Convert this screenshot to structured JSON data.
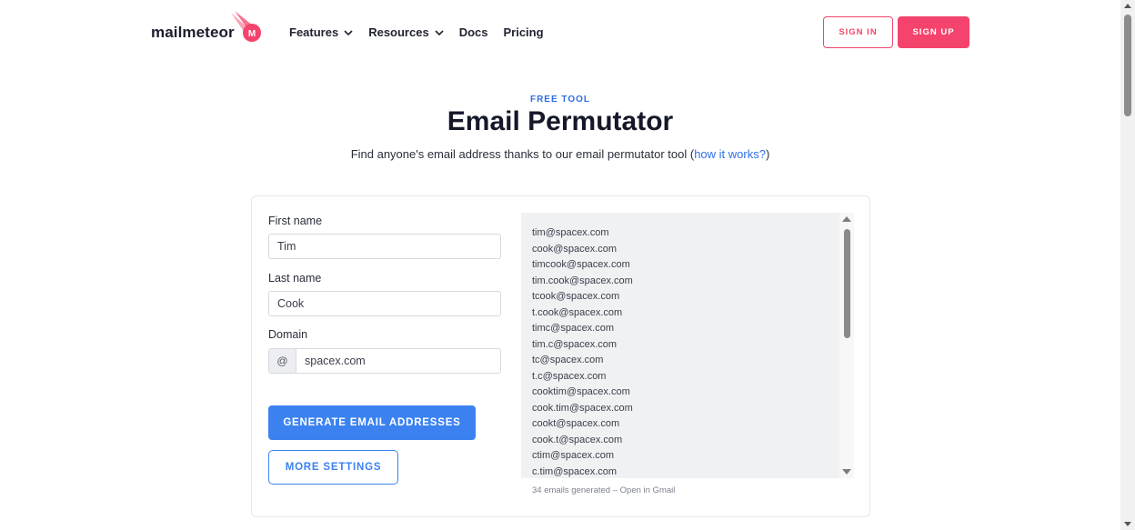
{
  "header": {
    "logo_text": "mailmeteor",
    "logo_icon": "meteor-logo-icon",
    "nav": [
      {
        "label": "Features",
        "dropdown": true
      },
      {
        "label": "Resources",
        "dropdown": true
      },
      {
        "label": "Docs",
        "dropdown": false
      },
      {
        "label": "Pricing",
        "dropdown": false
      }
    ],
    "signin_label": "SIGN IN",
    "signup_label": "SIGN UP"
  },
  "hero": {
    "eyebrow": "FREE TOOL",
    "title": "Email Permutator",
    "subtitle_text": "Find anyone's email address thanks to our email permutator tool (",
    "subtitle_link": "how it works?",
    "subtitle_end": ")"
  },
  "form": {
    "first_name_label": "First name",
    "first_name_value": "Tim",
    "last_name_label": "Last name",
    "last_name_value": "Cook",
    "domain_label": "Domain",
    "domain_prefix": "@",
    "domain_value": "spacex.com",
    "generate_label": "GENERATE EMAIL ADDRESSES",
    "more_settings_label": "MORE SETTINGS"
  },
  "results": {
    "emails": [
      "tim@spacex.com",
      "cook@spacex.com",
      "timcook@spacex.com",
      "tim.cook@spacex.com",
      "tcook@spacex.com",
      "t.cook@spacex.com",
      "timc@spacex.com",
      "tim.c@spacex.com",
      "tc@spacex.com",
      "t.c@spacex.com",
      "cooktim@spacex.com",
      "cook.tim@spacex.com",
      "cookt@spacex.com",
      "cook.t@spacex.com",
      "ctim@spacex.com",
      "c.tim@spacex.com"
    ],
    "footer_note": "34 emails generated – Open in Gmail"
  },
  "colors": {
    "brand_pink": "#f4436c",
    "accent_blue": "#3b82f0",
    "link_blue": "#2f6fe3"
  }
}
